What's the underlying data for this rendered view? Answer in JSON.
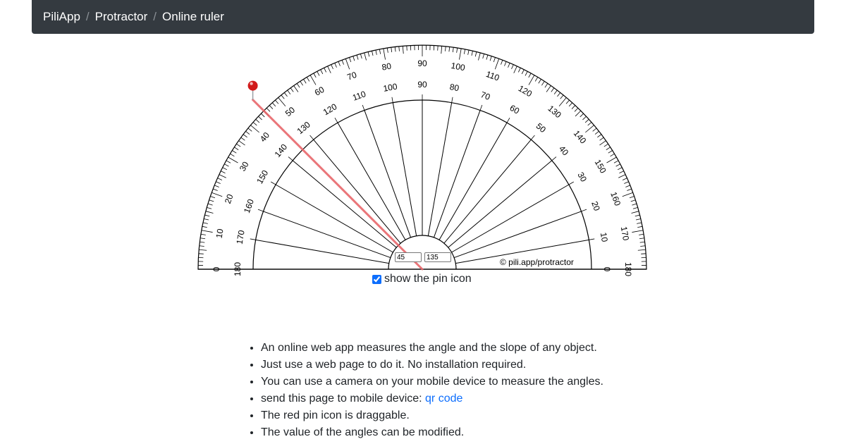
{
  "breadcrumb": [
    "PiliApp",
    "Protractor",
    "Online ruler"
  ],
  "protractor": {
    "outer_ticks_left": [
      "0",
      "10",
      "20",
      "30",
      "40",
      "50",
      "60",
      "70",
      "80",
      "90"
    ],
    "outer_ticks_right": [
      "100",
      "110",
      "120",
      "130",
      "140",
      "150",
      "160",
      "170",
      "180"
    ],
    "inner_labels_desc": [
      "180",
      "170",
      "160",
      "150",
      "140",
      "130",
      "120",
      "110",
      "100",
      "90",
      "80",
      "70",
      "60",
      "50",
      "40",
      "30",
      "20",
      "10",
      "0"
    ],
    "copyright": "© pili.app/protractor",
    "angle_left_value": "45",
    "angle_right_value": "135",
    "line_color": "#e8676b",
    "pin_color": "#d11a1a"
  },
  "show_pin": {
    "label": "show the pin icon",
    "checked": true
  },
  "info": {
    "items": [
      "An online web app measures the angle and the slope of any object.",
      "Just use a web page to do it. No installation required.",
      "You can use a camera on your mobile device to measure the angles.",
      "send this page to mobile device: ",
      "The red pin icon is draggable.",
      "The value of the angles can be modified."
    ],
    "qr_link": "qr code"
  }
}
